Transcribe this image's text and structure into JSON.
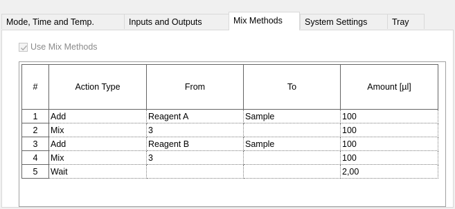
{
  "tabs": [
    {
      "label": "Mode, Time and Temp.",
      "active": false
    },
    {
      "label": "Inputs and Outputs",
      "active": false
    },
    {
      "label": "Mix Methods",
      "active": true
    },
    {
      "label": "System Settings",
      "active": false
    },
    {
      "label": "Tray",
      "active": false
    }
  ],
  "mix": {
    "use_label": "Use Mix Methods",
    "use_checked": true,
    "use_enabled": false
  },
  "table": {
    "headers": [
      "#",
      "Action Type",
      "From",
      "To",
      "Amount [µl]"
    ],
    "rows": [
      {
        "num": "1",
        "action": "Add",
        "from": "Reagent A",
        "to": "Sample",
        "amount": "100"
      },
      {
        "num": "2",
        "action": "Mix",
        "from": "3",
        "to": "",
        "amount": "100"
      },
      {
        "num": "3",
        "action": "Add",
        "from": "Reagent B",
        "to": "Sample",
        "amount": "100"
      },
      {
        "num": "4",
        "action": "Mix",
        "from": "3",
        "to": "",
        "amount": "100"
      },
      {
        "num": "5",
        "action": "Wait",
        "from": "",
        "to": "",
        "amount": "2,00"
      }
    ]
  },
  "colors": {
    "panel_bg": "#ffffff",
    "window_bg": "#f0f0f0",
    "disabled_text": "#8a8a8a"
  }
}
